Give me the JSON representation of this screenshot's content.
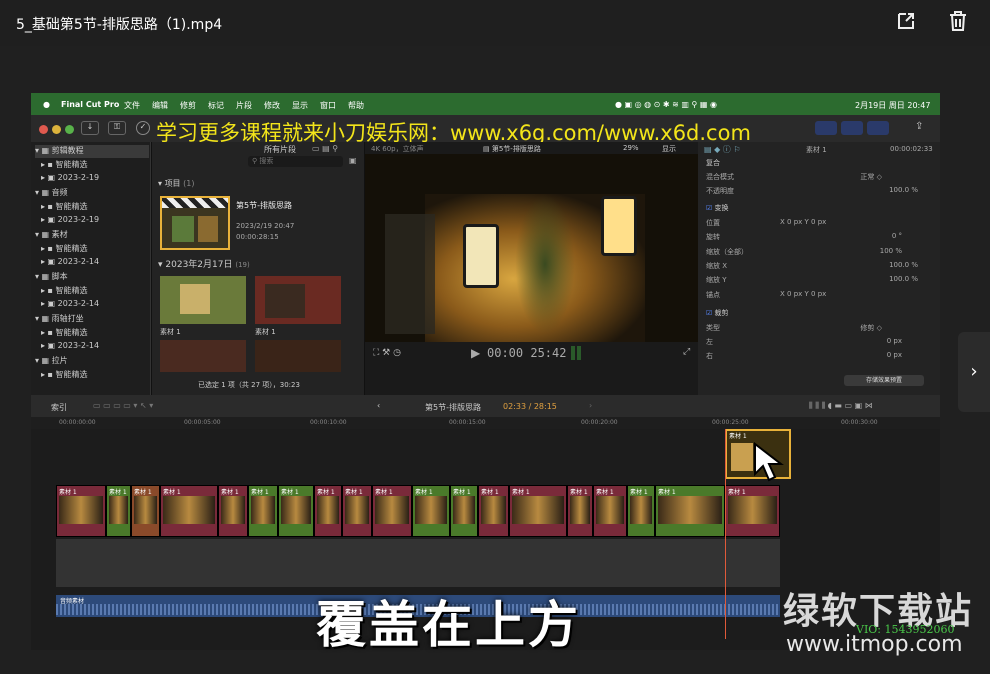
{
  "window": {
    "title": "5_基础第5节-排版思路（1).mp4",
    "share_icon": "share-icon",
    "delete_icon": "trash-icon"
  },
  "fcp": {
    "menu": {
      "apple": "",
      "app": "Final Cut Pro",
      "items": [
        "文件",
        "编辑",
        "修剪",
        "标记",
        "片段",
        "修改",
        "显示",
        "窗口",
        "帮助"
      ],
      "clock": "2月19日 周日 20:47"
    },
    "watermark": "学习更多课程就来小刀娱乐网：www.x6g.com/www.x6d.com",
    "library": {
      "rows": [
        {
          "label": "剪辑教程",
          "level": 0
        },
        {
          "label": "智能精选",
          "level": 1
        },
        {
          "label": "2023-2-19",
          "level": 1
        },
        {
          "label": "音频",
          "level": 0
        },
        {
          "label": "智能精选",
          "level": 1
        },
        {
          "label": "2023-2-19",
          "level": 1
        },
        {
          "label": "素材",
          "level": 0
        },
        {
          "label": "智能精选",
          "level": 1
        },
        {
          "label": "2023-2-14",
          "level": 1
        },
        {
          "label": "脚本",
          "level": 0
        },
        {
          "label": "智能精选",
          "level": 1
        },
        {
          "label": "2023-2-14",
          "level": 1
        },
        {
          "label": "雨轴打坐",
          "level": 0
        },
        {
          "label": "智能精选",
          "level": 1
        },
        {
          "label": "2023-2-14",
          "level": 1
        },
        {
          "label": "拉片",
          "level": 0
        },
        {
          "label": "智能精选",
          "level": 1
        }
      ]
    },
    "browser": {
      "filter": "所有片段",
      "search_placeholder": "搜索",
      "project_header": "项目",
      "project_count": "(1)",
      "project_name": "第5节-排版思路",
      "project_date": "2023/2/19 20:47",
      "project_duration": "00:00:28:15",
      "date_header": "2023年2月17日",
      "date_count": "(19)",
      "clip1": "素材 1",
      "clip2": "素材 1",
      "status": "已选定 1 项（共 27 项），30:23"
    },
    "viewer": {
      "format": "4K 60p，立体声",
      "project": "第5节-排版思路",
      "zoom": "29%",
      "display": "显示",
      "timecode": "00:00 25:42"
    },
    "inspector": {
      "clip": "素材 1",
      "duration": "00:00:02:33",
      "rows": [
        {
          "label": "复合",
          "value": ""
        },
        {
          "label": "混合模式",
          "value": "正常 ◇"
        },
        {
          "label": "不透明度",
          "value": "100.0 %"
        },
        {
          "label": "变换",
          "value": ""
        },
        {
          "label": "位置",
          "value": "X 0 px  Y 0 px"
        },
        {
          "label": "旋转",
          "value": "0 °"
        },
        {
          "label": "缩放（全部）",
          "value": "100 %"
        },
        {
          "label": "缩放 X",
          "value": "100.0 %"
        },
        {
          "label": "缩放 Y",
          "value": "100.0 %"
        },
        {
          "label": "锚点",
          "value": "X 0 px  Y 0 px"
        },
        {
          "label": "裁剪",
          "value": ""
        },
        {
          "label": "类型",
          "value": "修剪 ◇"
        },
        {
          "label": "左",
          "value": "0 px"
        },
        {
          "label": "右",
          "value": "0 px"
        }
      ],
      "save_button": "存储效果预置"
    },
    "timeline": {
      "index": "索引",
      "project": "第5节-排版思路",
      "position": "02:33 / 28:15",
      "ruler": [
        "00:00:00:00",
        "00:00:05:00",
        "00:00:10:00",
        "00:00:15:00",
        "00:00:20:00",
        "00:00:25:00",
        "00:00:30:00"
      ],
      "clip_label": "素材 1",
      "audio_label": "音频素材"
    }
  },
  "caption": "覆盖在上方",
  "brand": {
    "name": "绿软下载站",
    "url": "www.itmop.com",
    "sub": "VIO: 1543952060"
  }
}
